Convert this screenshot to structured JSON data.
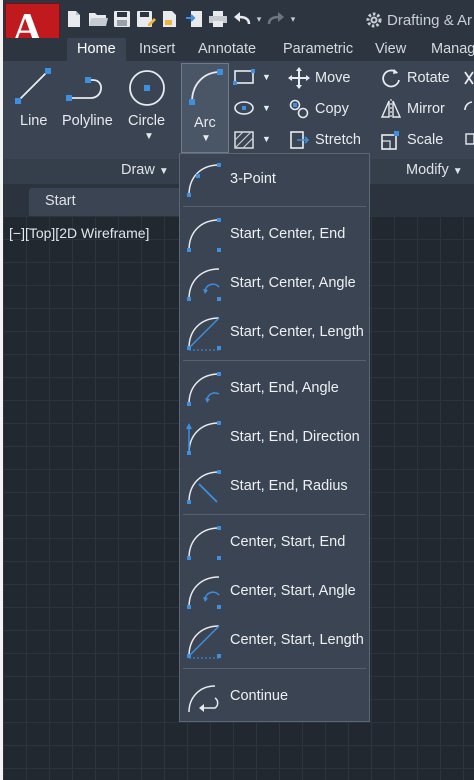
{
  "app": {
    "logo_letter": "A",
    "workspace": "Drafting & Ar"
  },
  "tabs": [
    {
      "label": "Home",
      "active": true
    },
    {
      "label": "Insert"
    },
    {
      "label": "Annotate"
    },
    {
      "label": "Parametric"
    },
    {
      "label": "View"
    },
    {
      "label": "Manag"
    }
  ],
  "ribbon": {
    "draw_tools": {
      "line": "Line",
      "polyline": "Polyline",
      "circle": "Circle",
      "arc": "Arc"
    },
    "draw_panel_label": "Draw",
    "modify_tools": {
      "move": "Move",
      "copy": "Copy",
      "stretch": "Stretch",
      "rotate": "Rotate",
      "mirror": "Mirror",
      "scale": "Scale"
    },
    "modify_panel_label": "Modify"
  },
  "file_tab": {
    "label": "Start"
  },
  "viewport": {
    "controls": "[−][Top][2D Wireframe]"
  },
  "arc_menu": {
    "items": [
      {
        "label": "3-Point"
      },
      {
        "label": "Start, Center, End"
      },
      {
        "label": "Start, Center, Angle"
      },
      {
        "label": "Start, Center, Length"
      },
      {
        "label": "Start, End, Angle"
      },
      {
        "label": "Start, End, Direction"
      },
      {
        "label": "Start, End, Radius"
      },
      {
        "label": "Center, Start, End"
      },
      {
        "label": "Center, Start, Angle"
      },
      {
        "label": "Center, Start, Length"
      },
      {
        "label": "Continue"
      }
    ]
  },
  "colors": {
    "app_red": "#c01a1f",
    "ribbon": "#3b4453",
    "canvas": "#212830",
    "accent_blue": "#3d8fe0"
  }
}
